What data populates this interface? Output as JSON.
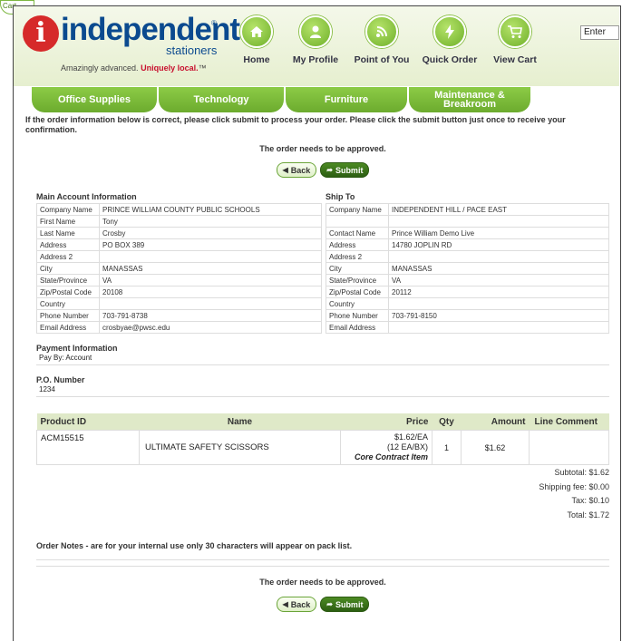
{
  "cart_tab": "Cart",
  "logo": {
    "word": "independent",
    "sub": "stationers",
    "reg": "®",
    "tagline_plain": "Amazingly advanced.",
    "tagline_bold": "Uniquely local.",
    "tm": "™"
  },
  "nav": [
    {
      "label": "Home",
      "icon": "home-icon"
    },
    {
      "label": "My Profile",
      "icon": "user-icon"
    },
    {
      "label": "Point of You",
      "icon": "signal-icon"
    },
    {
      "label": "Quick Order",
      "icon": "lightning-icon"
    },
    {
      "label": "View Cart",
      "icon": "cart-icon"
    }
  ],
  "enter": "Enter",
  "categories": [
    "Office Supplies",
    "Technology",
    "Furniture",
    "Maintenance & Breakroom"
  ],
  "intro": "If the order information below is correct, please click submit to process your order. Please click the submit button just once to receive your confirmation.",
  "approval_note": "The order needs to be approved.",
  "buttons": {
    "back": "Back",
    "submit": "Submit"
  },
  "main_account": {
    "title": "Main Account Information",
    "rows": [
      [
        "Company Name",
        "PRINCE WILLIAM COUNTY PUBLIC SCHOOLS"
      ],
      [
        "First Name",
        "Tony"
      ],
      [
        "Last Name",
        "Crosby"
      ],
      [
        "Address",
        "PO BOX 389"
      ],
      [
        "Address 2",
        ""
      ],
      [
        "City",
        "MANASSAS"
      ],
      [
        "State/Province",
        "VA"
      ],
      [
        "Zip/Postal Code",
        "20108"
      ],
      [
        "Country",
        ""
      ],
      [
        "Phone Number",
        "703-791-8738"
      ],
      [
        "Email Address",
        "crosbyae@pwsc.edu"
      ]
    ]
  },
  "ship_to": {
    "title": "Ship To",
    "rows": [
      [
        "Company Name",
        "INDEPENDENT HILL / PACE EAST"
      ],
      [
        "",
        ""
      ],
      [
        "Contact Name",
        "Prince William Demo Live"
      ],
      [
        "Address",
        "14780 JOPLIN RD"
      ],
      [
        "Address 2",
        ""
      ],
      [
        "City",
        "MANASSAS"
      ],
      [
        "State/Province",
        "VA"
      ],
      [
        "Zip/Postal Code",
        "20112"
      ],
      [
        "Country",
        ""
      ],
      [
        "Phone Number",
        "703-791-8150"
      ],
      [
        "Email Address",
        ""
      ]
    ]
  },
  "payment": {
    "title": "Payment Information",
    "value": "Pay By: Account"
  },
  "po": {
    "title": "P.O. Number",
    "value": "1234"
  },
  "products": {
    "headers": [
      "Product ID",
      "Name",
      "Price",
      "Qty",
      "Amount",
      "Line Comment"
    ],
    "rows": [
      {
        "id": "ACM15515",
        "name": "ULTIMATE SAFETY SCISSORS",
        "price_1": "$1.62/EA",
        "price_2": "(12 EA/BX)",
        "price_3": "Core Contract Item",
        "qty": "1",
        "amount": "$1.62",
        "comment": ""
      }
    ]
  },
  "totals": {
    "subtotal": "Subtotal: $1.62",
    "shipping": "Shipping fee: $0.00",
    "tax": "Tax: $0.10",
    "total": "Total: $1.72"
  },
  "order_notes": "Order Notes - are for your internal use only 30 characters will appear on pack list."
}
